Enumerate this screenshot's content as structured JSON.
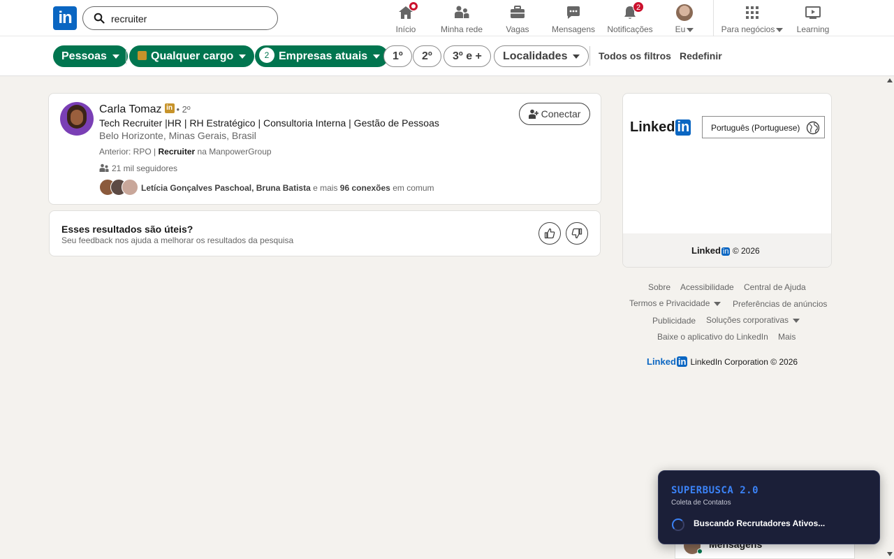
{
  "nav": {
    "search_value": "recruiter",
    "items": [
      {
        "label": "Início",
        "icon": "home-icon",
        "badge": ""
      },
      {
        "label": "Minha rede",
        "icon": "network-icon",
        "badge": ""
      },
      {
        "label": "Vagas",
        "icon": "briefcase-icon",
        "badge": ""
      },
      {
        "label": "Mensagens",
        "icon": "messaging-icon",
        "badge": ""
      },
      {
        "label": "Notificações",
        "icon": "bell-icon",
        "badge": "2"
      },
      {
        "label": "Eu",
        "icon": "avatar",
        "badge": ""
      },
      {
        "label": "Para negócios",
        "icon": "grid-icon",
        "badge": ""
      },
      {
        "label": "Learning",
        "icon": "learning-icon",
        "badge": ""
      }
    ]
  },
  "filters": {
    "people": "Pessoas",
    "any_title": "Qualquer cargo",
    "companies_count": "2",
    "companies": "Empresas atuais",
    "first": "1º",
    "second": "2º",
    "third": "3º e +",
    "locations": "Localidades",
    "all_filters": "Todos os filtros",
    "reset": "Redefinir"
  },
  "result": {
    "name": "Carla Tomaz",
    "degree": "• 2º",
    "headline": "Tech Recruiter |HR | RH Estratégico | Consultoria Interna | Gestão de Pessoas",
    "location": "Belo Horizonte, Minas Gerais, Brasil",
    "previous_prefix": "Anterior: RPO |",
    "previous_title": "Recruiter",
    "previous_suffix": "na ManpowerGroup",
    "followers": "21 mil seguidores",
    "mutual_names": "Letícia Gonçalves Paschoal, Bruna Batista",
    "mutual_and": "e mais",
    "mutual_count": "96 conexões",
    "mutual_suffix": "em comum",
    "connect_label": "Conectar"
  },
  "feedback": {
    "title": "Esses resultados são úteis?",
    "subtitle": "Seu feedback nos ajuda a melhorar os resultados da pesquisa"
  },
  "rail": {
    "logo_text": "Linked",
    "logo_in": "in",
    "language": "Português (Portuguese)",
    "copyright": "© 2026"
  },
  "footer": {
    "links": [
      "Sobre",
      "Acessibilidade",
      "Central de Ajuda",
      "Termos e Privacidade",
      "Preferências de anúncios",
      "Publicidade",
      "Soluções corporativas",
      "Baixe o aplicativo do LinkedIn",
      "Mais"
    ],
    "corp_logo": "Linked",
    "corp_logo_in": "in",
    "corp_text": "LinkedIn Corporation © 2026"
  },
  "messaging": {
    "label": "Mensagens"
  },
  "superbusca": {
    "title": "SUPERBUSCA 2.0",
    "subtitle": "Coleta de Contatos",
    "status": "Buscando Recrutadores Ativos..."
  },
  "colors": {
    "brand": "#0a66c2",
    "filter_active": "#01754f",
    "badge": "#cb112d",
    "popup_bg": "#1b1f38",
    "popup_accent": "#3b82f6"
  }
}
